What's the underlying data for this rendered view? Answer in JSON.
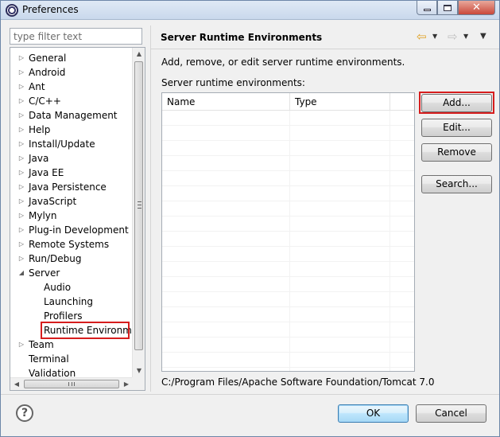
{
  "window": {
    "title": "Preferences",
    "minimize_icon": "minimize-icon",
    "maximize_icon": "maximize-icon",
    "close_label": "✕"
  },
  "filter": {
    "placeholder": "type filter text",
    "value": ""
  },
  "tree": {
    "items": [
      {
        "label": "General",
        "expanded": false,
        "child": false
      },
      {
        "label": "Android",
        "expanded": false,
        "child": false
      },
      {
        "label": "Ant",
        "expanded": false,
        "child": false
      },
      {
        "label": "C/C++",
        "expanded": false,
        "child": false
      },
      {
        "label": "Data Management",
        "expanded": false,
        "child": false
      },
      {
        "label": "Help",
        "expanded": false,
        "child": false
      },
      {
        "label": "Install/Update",
        "expanded": false,
        "child": false
      },
      {
        "label": "Java",
        "expanded": false,
        "child": false
      },
      {
        "label": "Java EE",
        "expanded": false,
        "child": false
      },
      {
        "label": "Java Persistence",
        "expanded": false,
        "child": false
      },
      {
        "label": "JavaScript",
        "expanded": false,
        "child": false
      },
      {
        "label": "Mylyn",
        "expanded": false,
        "child": false
      },
      {
        "label": "Plug-in Development",
        "expanded": false,
        "child": false
      },
      {
        "label": "Remote Systems",
        "expanded": false,
        "child": false
      },
      {
        "label": "Run/Debug",
        "expanded": false,
        "child": false
      },
      {
        "label": "Server",
        "expanded": true,
        "child": false
      },
      {
        "label": "Audio",
        "child": true
      },
      {
        "label": "Launching",
        "child": true
      },
      {
        "label": "Profilers",
        "child": true
      },
      {
        "label": "Runtime Environme",
        "child": true,
        "selected": true
      },
      {
        "label": "Team",
        "expanded": false,
        "child": false
      },
      {
        "label": "Terminal",
        "leaf": true,
        "child": false
      },
      {
        "label": "Validation",
        "leaf": true,
        "child": false
      }
    ]
  },
  "page": {
    "title": "Server Runtime Environments",
    "description": "Add, remove, or edit server runtime environments.",
    "list_label": "Server runtime environments:",
    "columns": [
      "Name",
      "Type"
    ],
    "rows": [],
    "path": "C:/Program Files/Apache Software Foundation/Tomcat 7.0",
    "nav": {
      "back_icon": "⇦",
      "forward_icon": "⇨",
      "dropdown_icon": "▼",
      "menu_icon": "▼"
    }
  },
  "buttons": {
    "add": "Add...",
    "edit": "Edit...",
    "remove": "Remove",
    "search": "Search...",
    "ok": "OK",
    "cancel": "Cancel",
    "help": "?"
  },
  "colors": {
    "highlight": "#d61d1d",
    "window_border": "#6d86a8"
  }
}
